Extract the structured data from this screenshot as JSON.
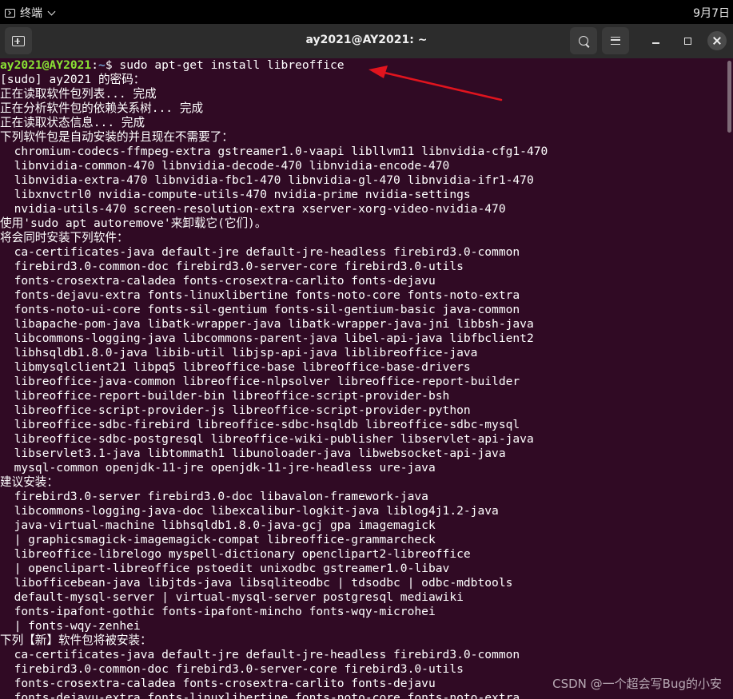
{
  "topbar": {
    "app_name": "终端",
    "date": "9月7日"
  },
  "window": {
    "title": "ay2021@AY2021: ~"
  },
  "prompt": {
    "user_host": "ay2021@AY2021",
    "sep": ":",
    "path": "~",
    "symbol": "$ ",
    "command": "sudo apt-get install libreoffice"
  },
  "output": [
    "[sudo] ay2021 的密码：",
    "正在读取软件包列表... 完成",
    "正在分析软件包的依赖关系树... 完成",
    "正在读取状态信息... 完成",
    "下列软件包是自动安装的并且现在不需要了：",
    "  chromium-codecs-ffmpeg-extra gstreamer1.0-vaapi libllvm11 libnvidia-cfg1-470",
    "  libnvidia-common-470 libnvidia-decode-470 libnvidia-encode-470",
    "  libnvidia-extra-470 libnvidia-fbc1-470 libnvidia-gl-470 libnvidia-ifr1-470",
    "  libxnvctrl0 nvidia-compute-utils-470 nvidia-prime nvidia-settings",
    "  nvidia-utils-470 screen-resolution-extra xserver-xorg-video-nvidia-470",
    "使用'sudo apt autoremove'来卸载它(它们)。",
    "将会同时安装下列软件：",
    "  ca-certificates-java default-jre default-jre-headless firebird3.0-common",
    "  firebird3.0-common-doc firebird3.0-server-core firebird3.0-utils",
    "  fonts-crosextra-caladea fonts-crosextra-carlito fonts-dejavu",
    "  fonts-dejavu-extra fonts-linuxlibertine fonts-noto-core fonts-noto-extra",
    "  fonts-noto-ui-core fonts-sil-gentium fonts-sil-gentium-basic java-common",
    "  libapache-pom-java libatk-wrapper-java libatk-wrapper-java-jni libbsh-java",
    "  libcommons-logging-java libcommons-parent-java libel-api-java libfbclient2",
    "  libhsqldb1.8.0-java libib-util libjsp-api-java liblibreoffice-java",
    "  libmysqlclient21 libpq5 libreoffice-base libreoffice-base-drivers",
    "  libreoffice-java-common libreoffice-nlpsolver libreoffice-report-builder",
    "  libreoffice-report-builder-bin libreoffice-script-provider-bsh",
    "  libreoffice-script-provider-js libreoffice-script-provider-python",
    "  libreoffice-sdbc-firebird libreoffice-sdbc-hsqldb libreoffice-sdbc-mysql",
    "  libreoffice-sdbc-postgresql libreoffice-wiki-publisher libservlet-api-java",
    "  libservlet3.1-java libtommath1 libunoloader-java libwebsocket-api-java",
    "  mysql-common openjdk-11-jre openjdk-11-jre-headless ure-java",
    "建议安装：",
    "  firebird3.0-server firebird3.0-doc libavalon-framework-java",
    "  libcommons-logging-java-doc libexcalibur-logkit-java liblog4j1.2-java",
    "  java-virtual-machine libhsqldb1.8.0-java-gcj gpa imagemagick",
    "  | graphicsmagick-imagemagick-compat libreoffice-grammarcheck",
    "  libreoffice-librelogo myspell-dictionary openclipart2-libreoffice",
    "  | openclipart-libreoffice pstoedit unixodbc gstreamer1.0-libav",
    "  libofficebean-java libjtds-java libsqliteodbc | tdsodbc | odbc-mdbtools",
    "  default-mysql-server | virtual-mysql-server postgresql mediawiki",
    "  fonts-ipafont-gothic fonts-ipafont-mincho fonts-wqy-microhei",
    "  | fonts-wqy-zenhei",
    "下列【新】软件包将被安装：",
    "  ca-certificates-java default-jre default-jre-headless firebird3.0-common",
    "  firebird3.0-common-doc firebird3.0-server-core firebird3.0-utils",
    "  fonts-crosextra-caladea fonts-crosextra-carlito fonts-dejavu",
    "  fonts-dejavu-extra fonts-linuxlibertine fonts-noto-core fonts-noto-extra"
  ],
  "watermark": "CSDN @一个超会写Bug的小安",
  "colors": {
    "background": "#300a24",
    "user_host": "#8ae234",
    "path": "#729fcf",
    "arrow": "#e0141e"
  },
  "icons": {
    "app": "terminal-icon",
    "new_tab": "new-tab-icon",
    "search": "search-icon",
    "menu": "hamburger-menu-icon",
    "minimize": "minimize-icon",
    "maximize": "maximize-icon",
    "close": "close-icon",
    "annotation": "red-arrow-annotation"
  }
}
